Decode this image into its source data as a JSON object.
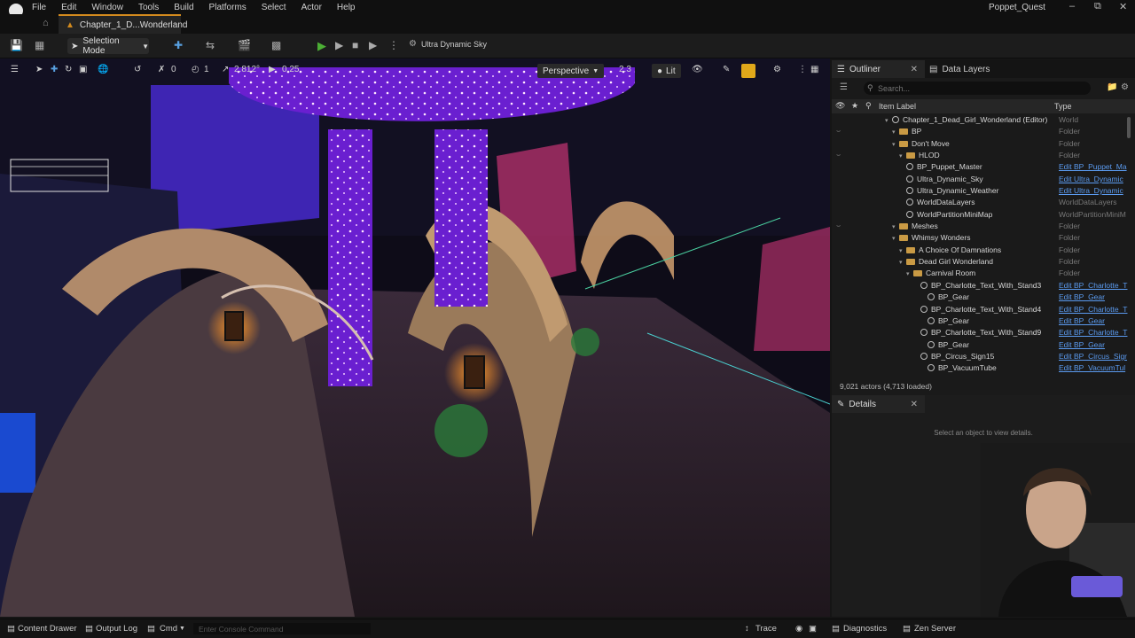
{
  "menu": {
    "items": [
      "File",
      "Edit",
      "Window",
      "Tools",
      "Build",
      "Platforms",
      "Select",
      "Actor",
      "Help"
    ],
    "project_name": "Poppet_Quest"
  },
  "tab": {
    "label": "Chapter_1_D...Wonderland"
  },
  "toolbar": {
    "selection_mode": "Selection Mode",
    "sky_label": "Ultra Dynamic Sky"
  },
  "viewport": {
    "snap_rotation": "1",
    "snap_scale": "2.812°",
    "camera_speed": "0.25",
    "grid_value": "0",
    "perspective_label": "Perspective",
    "fov_value": "2.3",
    "lit_label": "Lit"
  },
  "outliner": {
    "tab_label": "Outliner",
    "data_layers_label": "Data Layers",
    "search_placeholder": "Search...",
    "col_label": "Item Label",
    "col_type": "Type",
    "rows": [
      {
        "label": "Chapter_1_Dead_Girl_Wonderland (Editor)",
        "type": "World",
        "indent": 0,
        "kind": "world",
        "link": false
      },
      {
        "label": "BP",
        "type": "Folder",
        "indent": 1,
        "kind": "folder",
        "link": false
      },
      {
        "label": "Don't Move",
        "type": "Folder",
        "indent": 1,
        "kind": "folder",
        "link": false
      },
      {
        "label": "HLOD",
        "type": "Folder",
        "indent": 2,
        "kind": "folder",
        "link": false
      },
      {
        "label": "BP_Puppet_Master",
        "type": "Edit BP_Puppet_Ma",
        "indent": 2,
        "kind": "actor",
        "link": true
      },
      {
        "label": "Ultra_Dynamic_Sky",
        "type": "Edit Ultra_Dynamic",
        "indent": 2,
        "kind": "actor",
        "link": true
      },
      {
        "label": "Ultra_Dynamic_Weather",
        "type": "Edit Ultra_Dynamic",
        "indent": 2,
        "kind": "actor",
        "link": true
      },
      {
        "label": "WorldDataLayers",
        "type": "WorldDataLayers",
        "indent": 2,
        "kind": "actor",
        "link": false
      },
      {
        "label": "WorldPartitionMiniMap",
        "type": "WorldPartitionMiniM",
        "indent": 2,
        "kind": "actor",
        "link": false
      },
      {
        "label": "Meshes",
        "type": "Folder",
        "indent": 1,
        "kind": "folder",
        "link": false
      },
      {
        "label": "Whimsy Wonders",
        "type": "Folder",
        "indent": 1,
        "kind": "folder",
        "link": false
      },
      {
        "label": "A Choice Of Damnations",
        "type": "Folder",
        "indent": 2,
        "kind": "folder",
        "link": false
      },
      {
        "label": "Dead Girl Wonderland",
        "type": "Folder",
        "indent": 2,
        "kind": "folder",
        "link": false
      },
      {
        "label": "Carnival Room",
        "type": "Folder",
        "indent": 3,
        "kind": "folder",
        "link": false
      },
      {
        "label": "BP_Charlotte_Text_With_Stand3",
        "type": "Edit BP_Charlotte_T",
        "indent": 4,
        "kind": "actor",
        "link": true
      },
      {
        "label": "BP_Gear",
        "type": "Edit BP_Gear",
        "indent": 5,
        "kind": "actor",
        "link": true
      },
      {
        "label": "BP_Charlotte_Text_With_Stand4",
        "type": "Edit BP_Charlotte_T",
        "indent": 4,
        "kind": "actor",
        "link": true
      },
      {
        "label": "BP_Gear",
        "type": "Edit BP_Gear",
        "indent": 5,
        "kind": "actor",
        "link": true
      },
      {
        "label": "BP_Charlotte_Text_With_Stand9",
        "type": "Edit BP_Charlotte_T",
        "indent": 4,
        "kind": "actor",
        "link": true
      },
      {
        "label": "BP_Gear",
        "type": "Edit BP_Gear",
        "indent": 5,
        "kind": "actor",
        "link": true
      },
      {
        "label": "BP_Circus_Sign15",
        "type": "Edit BP_Circus_Sigr",
        "indent": 4,
        "kind": "actor",
        "link": true
      },
      {
        "label": "BP_VacuumTube",
        "type": "Edit BP_VacuumTul",
        "indent": 5,
        "kind": "actor",
        "link": true
      }
    ],
    "actor_count": "9,021 actors (4,713 loaded)"
  },
  "details": {
    "tab_label": "Details",
    "empty_text": "Select an object to view details."
  },
  "statusbar": {
    "content_drawer": "Content Drawer",
    "output_log": "Output Log",
    "cmd": "Cmd",
    "console_placeholder": "Enter Console Command",
    "trace": "Trace",
    "diagnostics": "Diagnostics",
    "zen_server": "Zen Server"
  },
  "colors": {
    "accent": "#d28a1e",
    "play": "#4caf35",
    "link": "#5b9bf0",
    "realtime": "#e0a81a"
  }
}
